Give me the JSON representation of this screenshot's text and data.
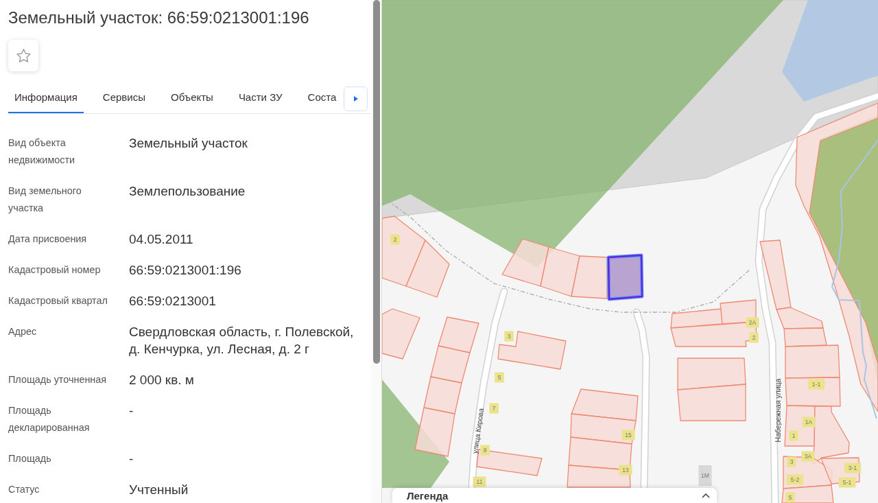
{
  "header": {
    "title": "Земельный участок: 66:59:0213001:196",
    "favorite": false
  },
  "tabs": [
    {
      "label": "Информация",
      "selected": true
    },
    {
      "label": "Сервисы",
      "selected": false
    },
    {
      "label": "Объекты",
      "selected": false
    },
    {
      "label": "Части ЗУ",
      "selected": false
    },
    {
      "label": "Соста",
      "selected": false
    }
  ],
  "fields": [
    {
      "label": "Вид объекта недвижимости",
      "value": "Земельный участок"
    },
    {
      "label": "Вид земельного участка",
      "value": "Землепользование"
    },
    {
      "label": "Дата присвоения",
      "value": "04.05.2011"
    },
    {
      "label": "Кадастровый номер",
      "value": "66:59:0213001:196"
    },
    {
      "label": "Кадастровый квартал",
      "value": "66:59:0213001"
    },
    {
      "label": "Адрес",
      "value": "Свердловская область, г. Полевской, д. Кенчурка, ул. Лесная, д. 2 г"
    },
    {
      "label": "Площадь уточненная",
      "value": "2 000 кв. м"
    },
    {
      "label": "Площадь декларированная",
      "value": "-"
    },
    {
      "label": "Площадь",
      "value": "-"
    },
    {
      "label": "Статус",
      "value": "Учтенный"
    }
  ],
  "map": {
    "parcels": [
      {
        "selected": false
      },
      {
        "selected": false
      },
      {
        "selected": false
      },
      {
        "selected": false
      },
      {
        "selected": false
      },
      {
        "selected": true
      },
      {
        "selected": false
      },
      {
        "selected": false
      },
      {
        "selected": false
      },
      {
        "selected": false
      },
      {
        "selected": false
      },
      {
        "selected": false
      },
      {
        "selected": false
      },
      {
        "selected": false
      },
      {
        "selected": false
      },
      {
        "selected": false
      },
      {
        "selected": false
      },
      {
        "selected": false
      },
      {
        "selected": false
      },
      {
        "selected": false
      },
      {
        "selected": false
      },
      {
        "selected": false
      },
      {
        "selected": false
      },
      {
        "selected": false
      },
      {
        "selected": false
      },
      {
        "selected": false
      },
      {
        "selected": false
      },
      {
        "selected": false
      },
      {
        "selected": false
      },
      {
        "selected": false
      },
      {
        "selected": false
      },
      {
        "selected": false
      },
      {
        "selected": false
      }
    ],
    "house_numbers": [
      {
        "text": "2",
        "kind": "house"
      },
      {
        "text": "3",
        "kind": "house"
      },
      {
        "text": "5",
        "kind": "house"
      },
      {
        "text": "7",
        "kind": "house"
      },
      {
        "text": "9",
        "kind": "house"
      },
      {
        "text": "11",
        "kind": "house"
      },
      {
        "text": "15",
        "kind": "house"
      },
      {
        "text": "13",
        "kind": "house"
      },
      {
        "text": "2А",
        "kind": "house"
      },
      {
        "text": "2",
        "kind": "house"
      },
      {
        "text": "1-1",
        "kind": "house"
      },
      {
        "text": "1А",
        "kind": "house"
      },
      {
        "text": "1",
        "kind": "house"
      },
      {
        "text": "3А",
        "kind": "house"
      },
      {
        "text": "3",
        "kind": "house"
      },
      {
        "text": "5-2",
        "kind": "house"
      },
      {
        "text": "3-1",
        "kind": "house"
      },
      {
        "text": "5-1",
        "kind": "house"
      },
      {
        "text": "5",
        "kind": "house"
      },
      {
        "text": "1М",
        "kind": "structure"
      }
    ],
    "street_labels": [
      "улица Кирова",
      "Набережная улица"
    ],
    "legend": {
      "title": "Легенда",
      "expanded": false
    }
  }
}
